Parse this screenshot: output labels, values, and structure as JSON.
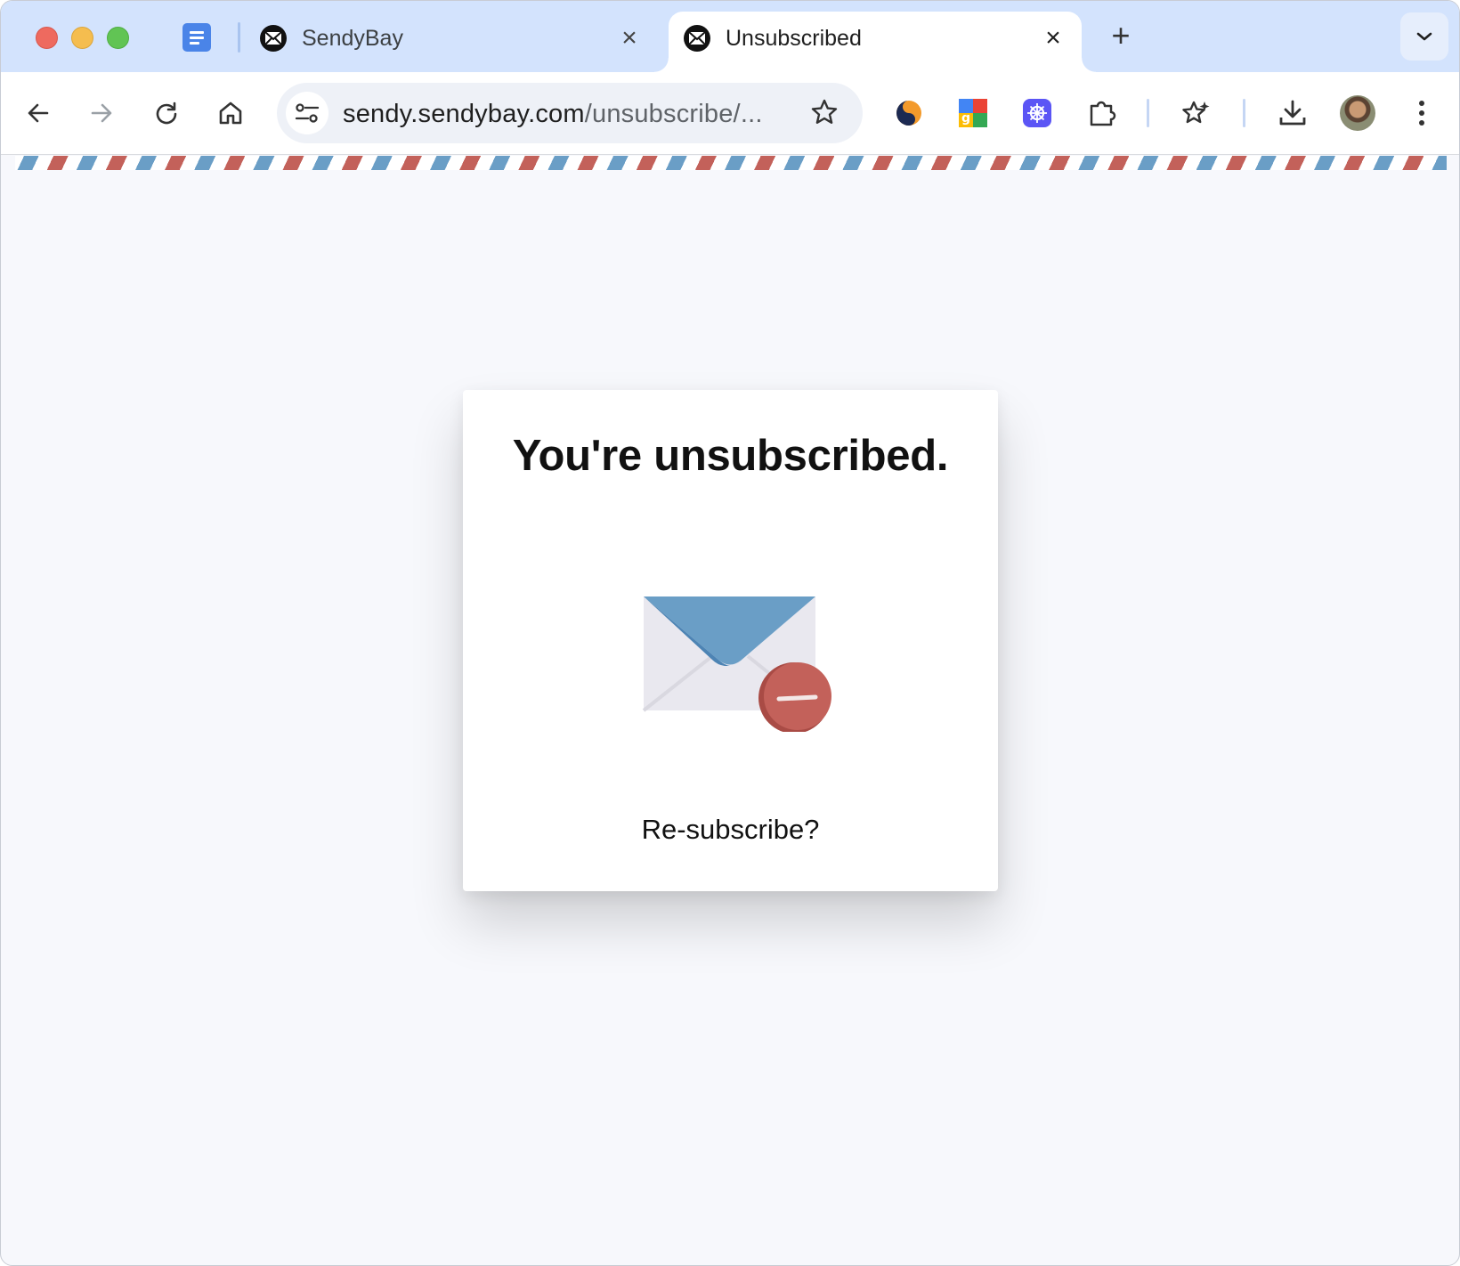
{
  "browser": {
    "tabs": [
      {
        "title": "SendyBay",
        "active": false
      },
      {
        "title": "Unsubscribed",
        "active": true
      }
    ],
    "address_bar": {
      "url_host": "sendy.sendybay.com",
      "url_path": "/unsubscribe/..."
    },
    "extension_icons": [
      "simplenote-icon",
      "google-translate-icon",
      "perplexity-icon",
      "extensions-puzzle-icon"
    ],
    "colors": {
      "tab_strip": "#d3e3fd",
      "active_tab": "#ffffff",
      "omnibox": "#eef1f7"
    }
  },
  "page": {
    "title": "You're unsubscribed.",
    "resubscribe_link": "Re-subscribe?",
    "illustration": "envelope-unsubscribe-icon",
    "colors": {
      "background": "#f7f8fc",
      "stripe_blue": "#6a9ec6",
      "stripe_red": "#c3615a",
      "envelope_flap": "#6a9ec6",
      "minus_badge": "#c3615a"
    }
  }
}
